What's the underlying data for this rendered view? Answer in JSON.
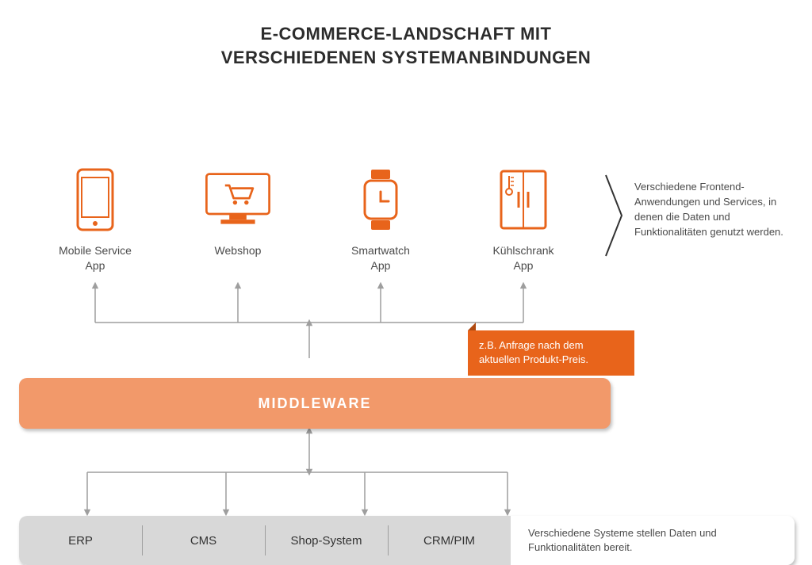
{
  "title_line1": "E-COMMERCE-LANDSCHAFT MIT",
  "title_line2": "VERSCHIEDENEN SYSTEMANBINDUNGEN",
  "frontends": [
    {
      "label": "Mobile Service\nApp",
      "icon": "mobile"
    },
    {
      "label": "Webshop",
      "icon": "desktop-cart"
    },
    {
      "label": "Smartwatch\nApp",
      "icon": "smartwatch"
    },
    {
      "label": "Kühlschrank\nApp",
      "icon": "fridge"
    }
  ],
  "frontend_description": "Verschiedene Frontend-Anwendungen und Services, in denen die Daten und Funktionalitäten genutzt werden.",
  "callout": "z.B. Anfrage nach dem aktuellen Produkt-Preis.",
  "middleware_label": "MIDDLEWARE",
  "backends": [
    "ERP",
    "CMS",
    "Shop-System",
    "CRM/PIM"
  ],
  "backend_description": "Verschiedene Systeme stellen Daten und Funktionalitäten bereit."
}
